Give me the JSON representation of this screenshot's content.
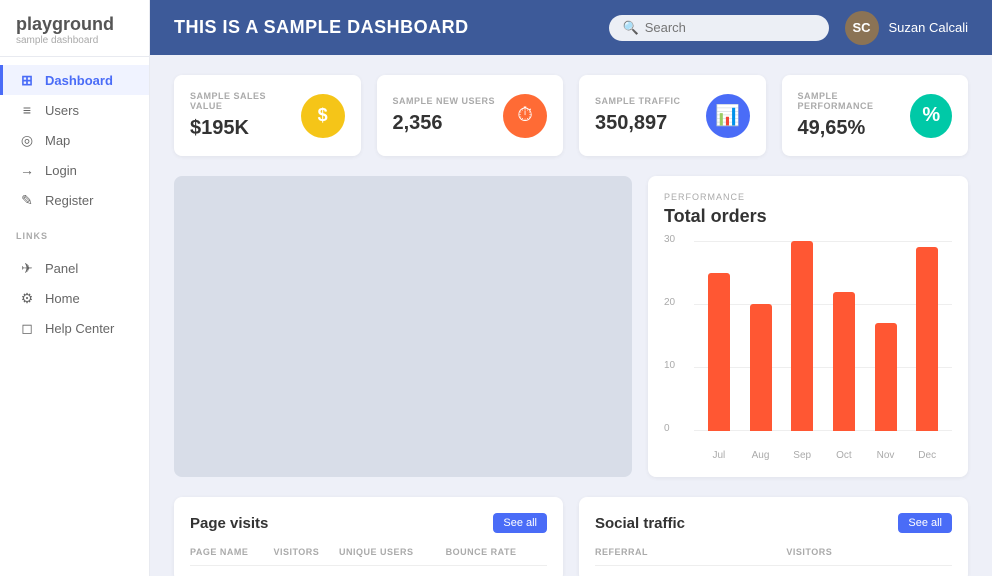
{
  "sidebar": {
    "logo": "playground",
    "logo_sub": "sample dashboard",
    "nav_items": [
      {
        "label": "Dashboard",
        "icon": "⊞",
        "active": true,
        "name": "dashboard"
      },
      {
        "label": "Users",
        "icon": "≡",
        "active": false,
        "name": "users"
      },
      {
        "label": "Map",
        "icon": "◎",
        "active": false,
        "name": "map"
      },
      {
        "label": "Login",
        "icon": "→",
        "active": false,
        "name": "login"
      },
      {
        "label": "Register",
        "icon": "✎",
        "active": false,
        "name": "register"
      }
    ],
    "links_label": "LINKS",
    "link_items": [
      {
        "label": "Panel",
        "icon": "✈",
        "name": "panel"
      },
      {
        "label": "Home",
        "icon": "⚙",
        "name": "home"
      },
      {
        "label": "Help Center",
        "icon": "◻",
        "name": "help-center"
      }
    ]
  },
  "header": {
    "title": "THIS IS A SAMPLE DASHBOARD",
    "search_placeholder": "Search",
    "username": "Suzan Calcali"
  },
  "stats": [
    {
      "label": "SAMPLE SALES VALUE",
      "value": "$195K",
      "icon": "$",
      "color": "#f5c518",
      "name": "sales"
    },
    {
      "label": "SAMPLE NEW USERS",
      "value": "2,356",
      "icon": "⏱",
      "color": "#ff6b35",
      "name": "users"
    },
    {
      "label": "SAMPLE TRAFFIC",
      "value": "350,897",
      "icon": "📊",
      "color": "#4a6cf7",
      "name": "traffic"
    },
    {
      "label": "SAMPLE PERFORMANCE",
      "value": "49,65%",
      "icon": "%",
      "color": "#00c9a7",
      "name": "performance"
    }
  ],
  "performance": {
    "section_label": "PERFORMANCE",
    "title": "Total orders",
    "chart": {
      "y_labels": [
        "30",
        "20",
        "10",
        "0"
      ],
      "bars": [
        {
          "month": "Jul",
          "value": 25
        },
        {
          "month": "Aug",
          "value": 20
        },
        {
          "month": "Sep",
          "value": 30
        },
        {
          "month": "Oct",
          "value": 22
        },
        {
          "month": "Nov",
          "value": 17
        },
        {
          "month": "Dec",
          "value": 29
        }
      ]
    }
  },
  "page_visits": {
    "title": "Page visits",
    "see_all": "See all",
    "columns": [
      "PAGE NAME",
      "VISITORS",
      "UNIQUE USERS",
      "BOUNCE RATE"
    ]
  },
  "social_traffic": {
    "title": "Social traffic",
    "see_all": "See all",
    "columns": [
      "REFERRAL",
      "VISITORS"
    ]
  }
}
